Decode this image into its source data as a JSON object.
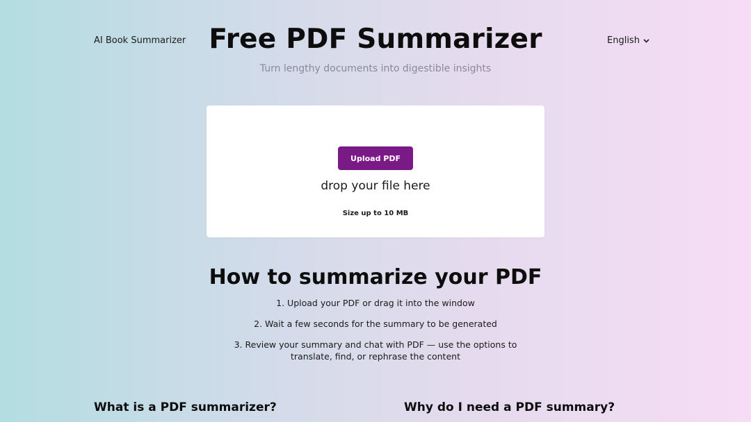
{
  "header": {
    "nav_link": "AI Book Summarizer",
    "title": "Free PDF Summarizer",
    "subtitle": "Turn lengthy documents into digestible insights",
    "language": "English",
    "language_icon": "chevron-down-icon"
  },
  "upload": {
    "button_label": "Upload PDF",
    "drop_text": "drop your file here",
    "size_limit": "Size up to 10 MB",
    "button_color": "#7a1a86"
  },
  "how_to": {
    "title": "How to summarize your PDF",
    "steps": [
      "1. Upload your PDF or drag it into the window",
      "2. Wait a few seconds for the summary to be generated",
      "3. Review your summary and chat with PDF — use the options to translate, find, or rephrase the content"
    ]
  },
  "sections": {
    "left_heading": "What is a PDF summarizer?",
    "right_heading": "Why do I need a PDF summary?"
  }
}
